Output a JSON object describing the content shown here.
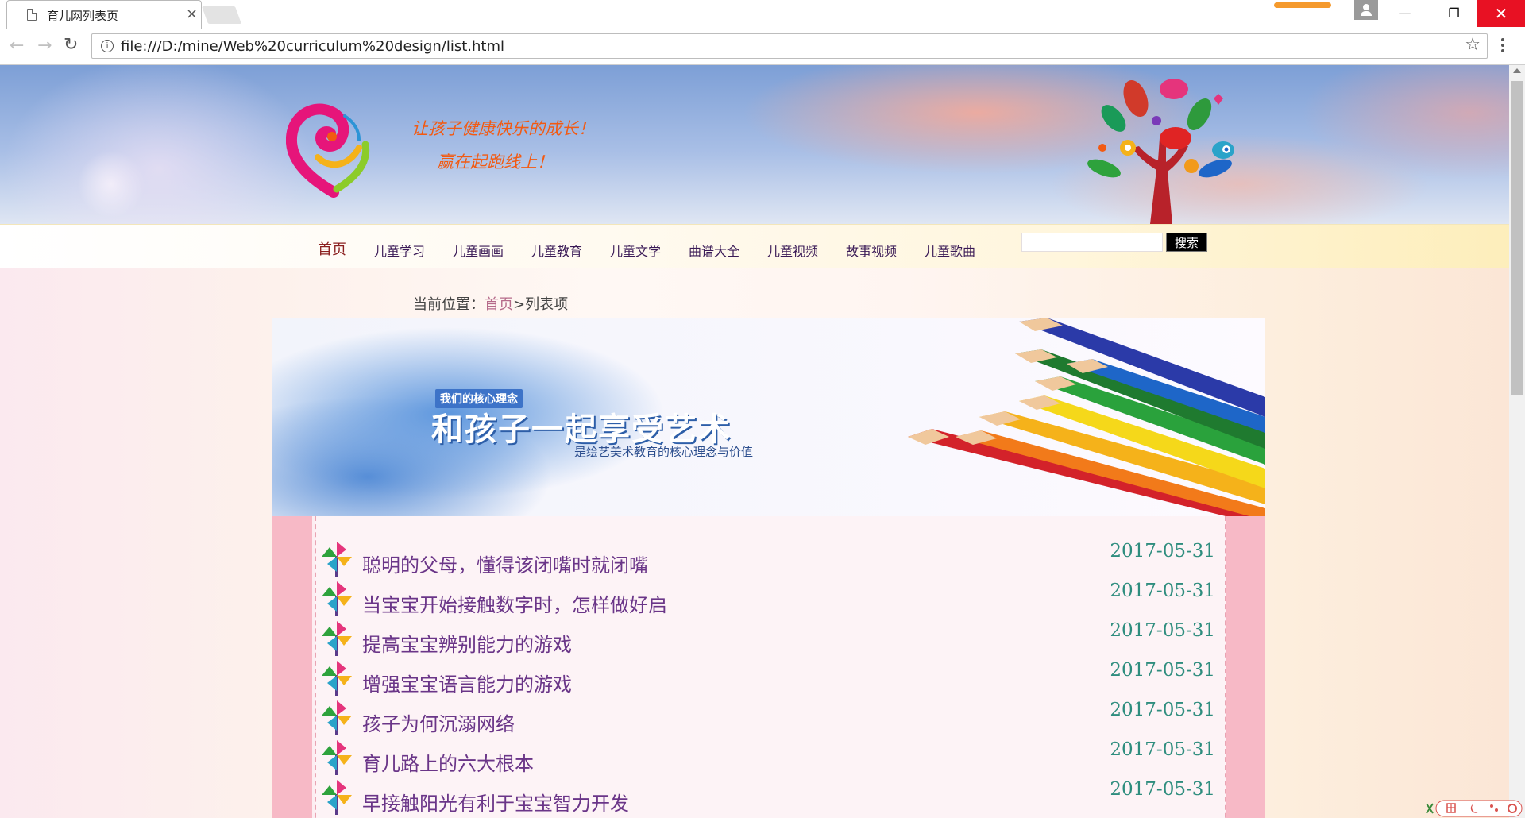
{
  "browser": {
    "tab_title": "育儿网列表页",
    "close_glyph": "×",
    "url": "file:///D:/mine/Web%20curriculum%20design/list.html",
    "nav_back": "←",
    "nav_forward": "→",
    "reload": "↻",
    "star": "☆",
    "win_minimize": "—",
    "win_maximize": "❐",
    "win_close": "✕"
  },
  "header": {
    "slogan_line1": "让孩子健康快乐的成长！",
    "slogan_line2": "赢在起跑线上！"
  },
  "nav": {
    "items": [
      "首页",
      "儿童学习",
      "儿童画画",
      "儿童教育",
      "儿童文学",
      "曲谱大全",
      "儿童视频",
      "故事视频",
      "儿童歌曲"
    ],
    "search_button": "搜索"
  },
  "breadcrumb": {
    "prefix": "当前位置：",
    "home": "首页",
    "separator": ">",
    "current": "列表项"
  },
  "hero": {
    "kicker": "我们的核心理念",
    "title": "和孩子一起享受艺术",
    "subtitle": "是绘艺美术教育的核心理念与价值"
  },
  "articles": [
    {
      "title": "聪明的父母，懂得该闭嘴时就闭嘴",
      "date": "2017-05-31"
    },
    {
      "title": "当宝宝开始接触数字时，怎样做好启",
      "date": "2017-05-31"
    },
    {
      "title": "提高宝宝辨别能力的游戏",
      "date": "2017-05-31"
    },
    {
      "title": "增强宝宝语言能力的游戏",
      "date": "2017-05-31"
    },
    {
      "title": "孩子为何沉溺网络",
      "date": "2017-05-31"
    },
    {
      "title": "育儿路上的六大根本",
      "date": "2017-05-31"
    },
    {
      "title": "早接触阳光有利于宝宝智力开发",
      "date": "2017-05-31"
    }
  ],
  "colors": {
    "slogan": "#f25a12",
    "article_title": "#6a3588",
    "article_date": "#2e8d7e",
    "side_border": "#f7b9c6",
    "close_button": "#e81123"
  },
  "icons": {
    "list_bullet": "pinwheel-icon",
    "logo": "heart-logo-icon",
    "tree": "colorful-tree-icon"
  }
}
